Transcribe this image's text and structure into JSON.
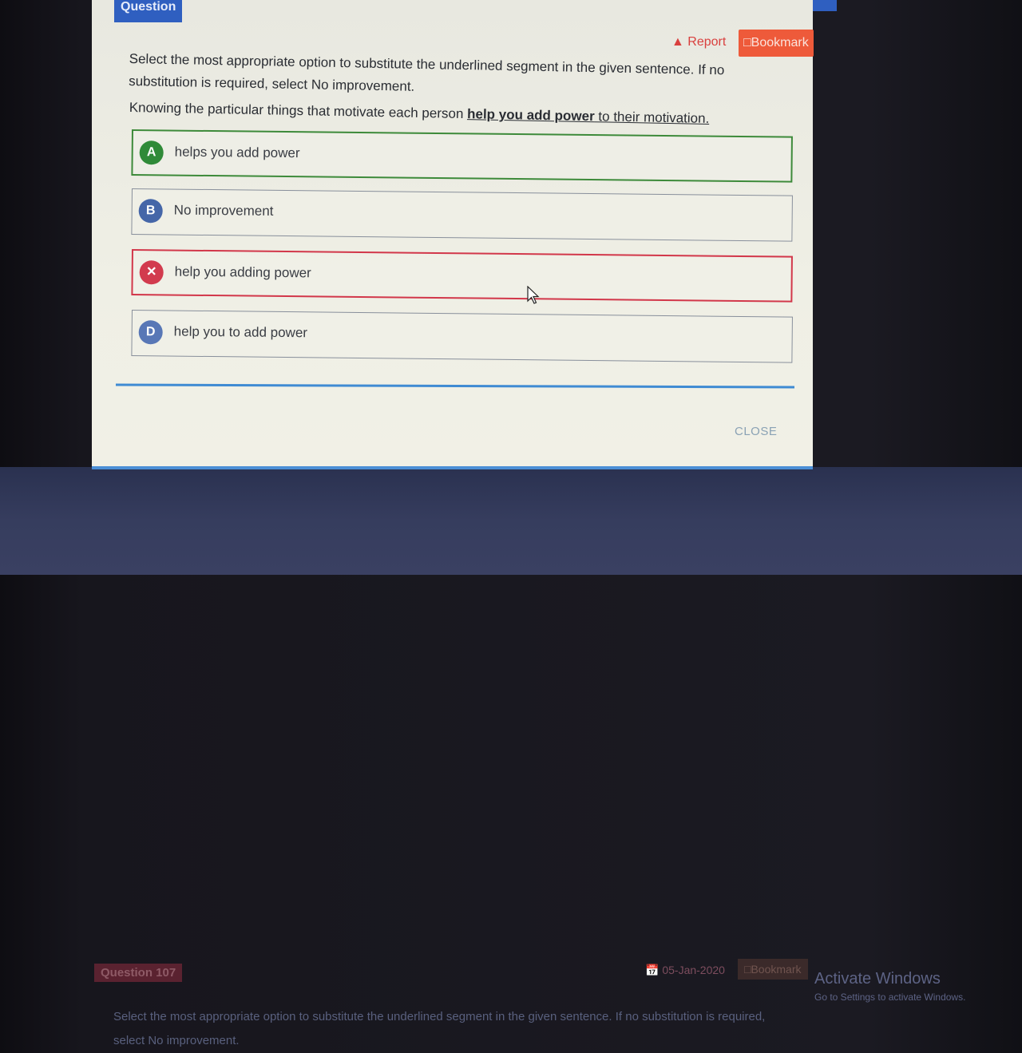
{
  "modal": {
    "tab_label": "Question",
    "report_label": "Report",
    "bookmark_label": "Bookmark",
    "instruction": "Select the most appropriate option to substitute the underlined segment in the given sentence. If no substitution is required, select No improvement.",
    "sentence": {
      "before": "Knowing the particular things that motivate each person ",
      "underlined": "help you add power",
      "after": " to their motivation."
    },
    "options": [
      {
        "badge": "A",
        "text": "helps you add power",
        "state": "correct"
      },
      {
        "badge": "B",
        "text": "No improvement",
        "state": "normal"
      },
      {
        "badge": "✕",
        "text": "help you adding power",
        "state": "wrong"
      },
      {
        "badge": "D",
        "text": "help you to add power",
        "state": "normal"
      }
    ],
    "close_label": "CLOSE"
  },
  "background": {
    "question_label": "Question 107",
    "date": "05-Jan-2020",
    "bookmark_label": "Bookmark",
    "text": "Select the most appropriate option to substitute the underlined segment in the given sentence. If no substitution is required, select No improvement."
  },
  "watermark": {
    "title": "Activate Windows",
    "subtitle": "Go to Settings to activate Windows."
  },
  "colors": {
    "primary": "#2f5fc0",
    "correct": "#3d8a3a",
    "wrong": "#d2374a",
    "bookmark": "#ee5a3a"
  }
}
